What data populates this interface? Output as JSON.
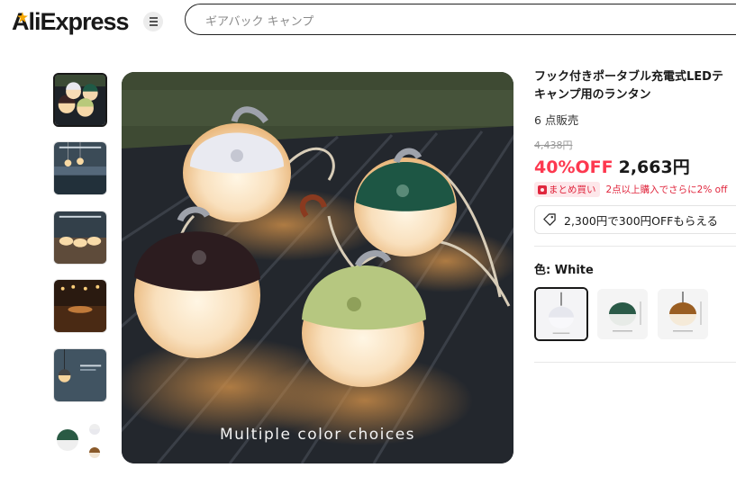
{
  "header": {
    "logo": "AliExpress",
    "search_placeholder": "ギアバック キャンプ"
  },
  "gallery": {
    "thumbnails": [
      {
        "name": "Lanterns on table"
      },
      {
        "name": "Lanterns by lake"
      },
      {
        "name": "Lanterns on deck"
      },
      {
        "name": "Lights at night"
      },
      {
        "name": "Single lantern"
      },
      {
        "name": "Lantern colors"
      }
    ],
    "main_caption": "Multiple color choices"
  },
  "product": {
    "title_line1": "フック付きポータブル充電式LEDテ",
    "title_line2": "キャンプ用のランタン",
    "sold": "6 点販売",
    "original_price": "4,438円",
    "discount": "40%OFF",
    "price": "2,663円",
    "bundle_tag": "まとめ買い",
    "bundle_text": "2点以上購入でさらに2% off",
    "coupon_text": "2,300円で300円OFFもらえる",
    "color_label": "色: White",
    "colors": [
      "White",
      "Green",
      "Brown"
    ]
  },
  "colors": {
    "accent_red": "#fd384f",
    "text": "#191919",
    "muted": "#999999"
  }
}
